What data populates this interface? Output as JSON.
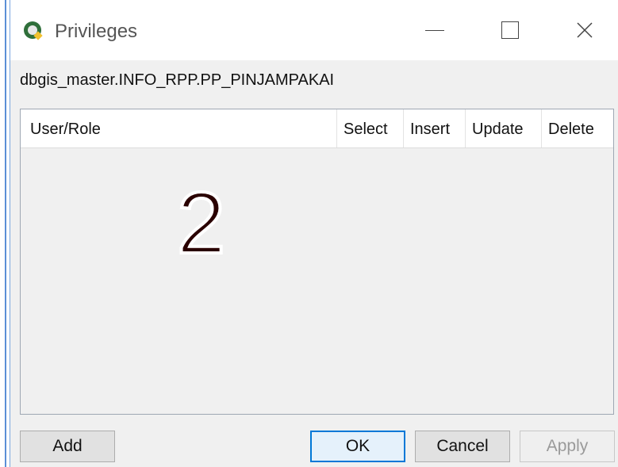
{
  "window": {
    "title": "Privileges",
    "path": "dbgis_master.INFO_RPP.PP_PINJAMPAKAI"
  },
  "table": {
    "columns": [
      "User/Role",
      "Select",
      "Insert",
      "Update",
      "Delete"
    ],
    "rows": []
  },
  "annotation": {
    "number": "2",
    "color": "#2a0000"
  },
  "buttons": {
    "add": "Add",
    "ok": "OK",
    "cancel": "Cancel",
    "apply": "Apply"
  },
  "colors": {
    "accent": "#0078d7",
    "disabled_text": "#9a9a9a"
  }
}
